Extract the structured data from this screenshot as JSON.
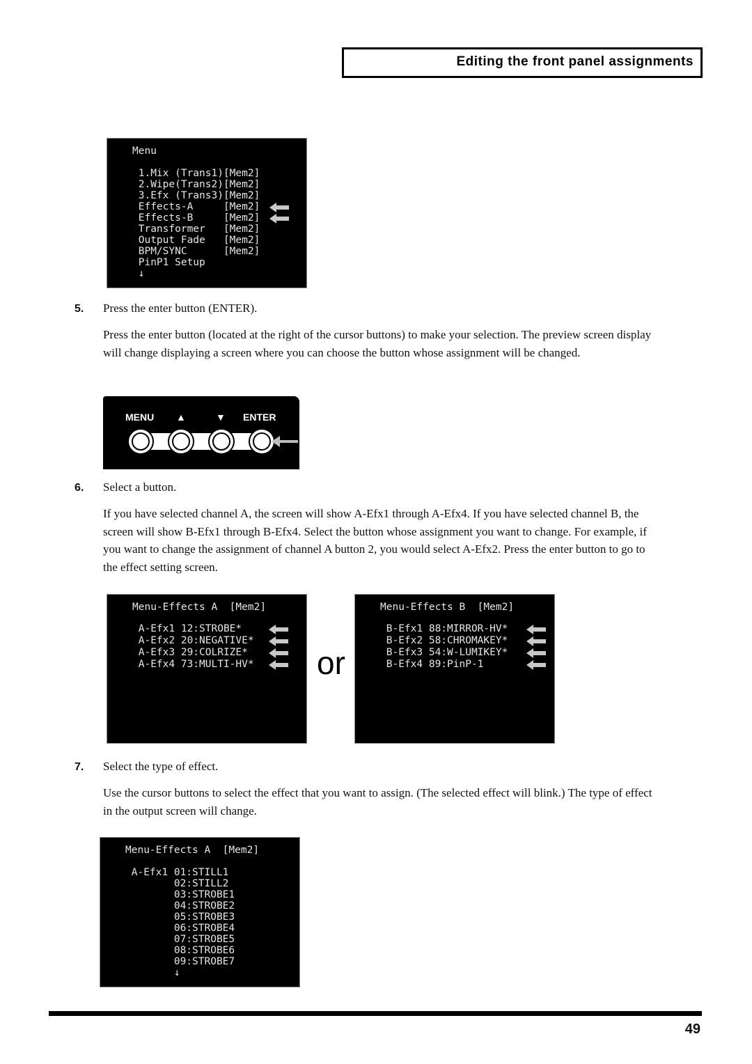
{
  "header": {
    "title": "Editing the front panel assignments"
  },
  "screen_menu": {
    "lines": [
      "Menu",
      "",
      " 1.Mix (Trans1)[Mem2]",
      " 2.Wipe(Trans2)[Mem2]",
      " 3.Efx (Trans3)[Mem2]",
      " Effects-A     [Mem2]",
      " Effects-B     [Mem2]",
      " Transformer   [Mem2]",
      " Output Fade   [Mem2]",
      " BPM/SYNC      [Mem2]",
      " PinP1 Setup",
      " ↓"
    ],
    "arrow_icon": "arrow-left-icon"
  },
  "steps": [
    {
      "number": "5.",
      "title": "Press the enter button (ENTER).",
      "body": "Press the enter button (located at the right of the cursor buttons) to make your selection. The preview screen display will change displaying a screen where you can choose the button whose assignment will be changed."
    },
    {
      "number": "6.",
      "title": "Select a button.",
      "body": "If you have selected channel A, the screen will show A-Efx1 through A-Efx4. If you have selected channel B, the screen will show B-Efx1 through B-Efx4. Select the button whose assignment you want to change. For example, if you want to change the assignment of channel A button 2, you would select A-Efx2. Press the enter button to go to the effect setting screen."
    },
    {
      "number": "7.",
      "title": "Select the type of effect.",
      "body": "Use the cursor buttons to select the effect that you want to assign. (The selected effect will blink.) The type of effect in the output screen will change."
    }
  ],
  "panel": {
    "labels": [
      "MENU",
      "▲",
      "▼",
      "ENTER"
    ]
  },
  "screen_effects_a": {
    "lines": [
      "Menu-Effects A  [Mem2]",
      "",
      " A-Efx1 12:STROBE*",
      " A-Efx2 20:NEGATIVE*",
      " A-Efx3 29:COLRIZE*",
      " A-Efx4 73:MULTI-HV*"
    ]
  },
  "or_label": "or",
  "screen_effects_b": {
    "lines": [
      "Menu-Effects B  [Mem2]",
      "",
      " B-Efx1 88:MIRROR-HV*",
      " B-Efx2 58:CHROMAKEY*",
      " B-Efx3 54:W-LUMIKEY*",
      " B-Efx4 89:PinP-1"
    ]
  },
  "screen_effect_list": {
    "lines": [
      "Menu-Effects A  [Mem2]",
      "",
      " A-Efx1 01:STILL1",
      "        02:STILL2",
      "        03:STROBE1",
      "        04:STROBE2",
      "        05:STROBE3",
      "        06:STROBE4",
      "        07:STROBE5",
      "        08:STROBE6",
      "        09:STROBE7",
      "        ↓"
    ]
  },
  "footer": {
    "page_number": "49"
  }
}
